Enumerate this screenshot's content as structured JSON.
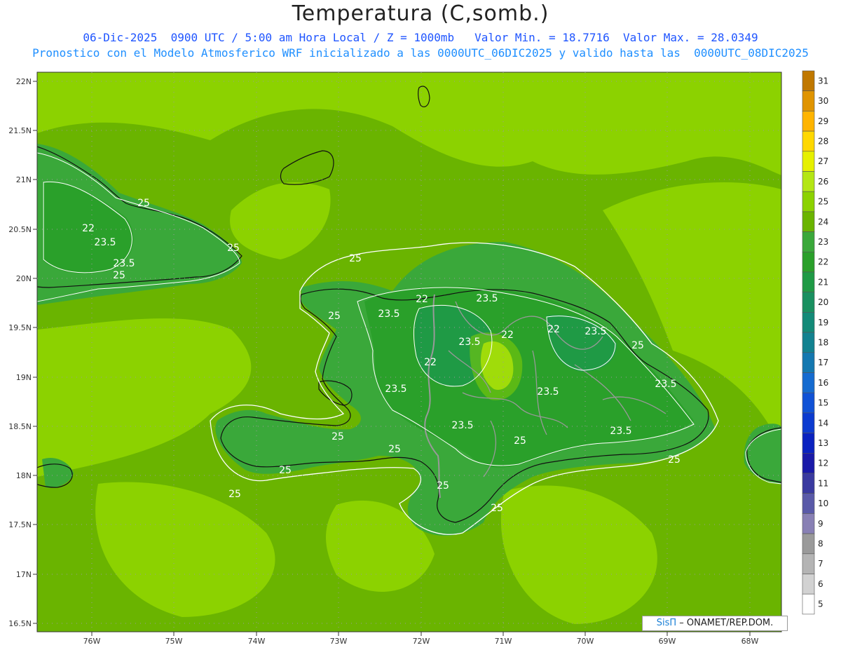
{
  "title": "Temperatura (C,somb.)",
  "subtitle_line1": "06-Dic-2025  0900 UTC / 5:00 am Hora Local / Z = 1000mb   Valor Min. = 18.7716  Valor Max. = 28.0349",
  "subtitle_line2": "Pronostico con el Modelo Atmosferico WRF inicializado a las 0000UTC_06DIC2025 y valido hasta las  0000UTC_08DIC2025",
  "credit": {
    "brand": "SisΠ",
    "text": "– ONAMET/REP.DOM."
  },
  "axes": {
    "lat_labels": [
      "22N",
      "21.5N",
      "21N",
      "20.5N",
      "20N",
      "19.5N",
      "19N",
      "18.5N",
      "18N",
      "17.5N",
      "17N",
      "16.5N"
    ],
    "lon_labels": [
      "76W",
      "75W",
      "74W",
      "73W",
      "72W",
      "71W",
      "70W",
      "69W",
      "68W"
    ]
  },
  "contour_labels": [
    "25",
    "22",
    "23.5",
    "23.5",
    "25",
    "25",
    "25",
    "22",
    "23.5",
    "25",
    "23.5",
    "22",
    "22",
    "23.5",
    "23.5",
    "22",
    "25",
    "23.5",
    "23.5",
    "23.5",
    "23.5",
    "23.5",
    "25",
    "25",
    "25",
    "25",
    "25",
    "25",
    "25",
    "25"
  ],
  "colorbar": {
    "labels": [
      "31",
      "30",
      "29",
      "28",
      "27",
      "26",
      "25",
      "24",
      "23",
      "22",
      "21",
      "20",
      "19",
      "18",
      "17",
      "16",
      "15",
      "14",
      "13",
      "12",
      "11",
      "10",
      "9",
      "8",
      "7",
      "6",
      "5"
    ],
    "colors": [
      "#c07800",
      "#e09400",
      "#ffb400",
      "#ffd800",
      "#e6f000",
      "#b4e614",
      "#8cd200",
      "#6ab400",
      "#3aa83a",
      "#2aa02a",
      "#1f9a45",
      "#199060",
      "#138a78",
      "#128290",
      "#1478b0",
      "#156bd0",
      "#1052d6",
      "#0c3bd0",
      "#0a22c0",
      "#1a1aa8",
      "#3a3aa0",
      "#5a5aa8",
      "#8880b4",
      "#9a9a9a",
      "#b4b4b4",
      "#d2d2d2",
      "#ffffff"
    ]
  }
}
